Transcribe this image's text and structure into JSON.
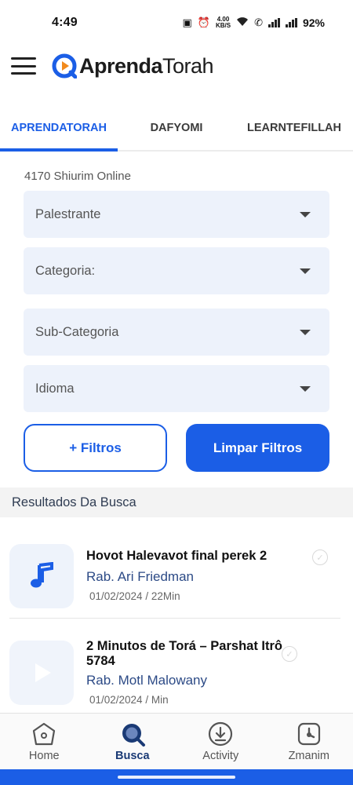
{
  "status_bar": {
    "time": "4:49",
    "speed_top": "4.00",
    "speed_bottom": "KB/S",
    "battery": "92%"
  },
  "header": {
    "brand_bold": "Aprenda",
    "brand_light": "Torah",
    "accent_color": "#1b5ee6"
  },
  "tabs": [
    {
      "label": "APRENDATORAH",
      "active": true
    },
    {
      "label": "DAFYOMI",
      "active": false
    },
    {
      "label": "LEARNTEFILLAH",
      "active": false
    }
  ],
  "filters": {
    "count_label": "4170 Shiurim Online",
    "selects": [
      {
        "placeholder": "Palestrante"
      },
      {
        "placeholder": "Categoria:"
      },
      {
        "placeholder": "Sub-Categoria"
      },
      {
        "placeholder": "Idioma"
      }
    ],
    "more_filters_label": "+ Filtros",
    "clear_filters_label": "Limpar Filtros"
  },
  "results": {
    "heading": "Resultados Da Busca",
    "items": [
      {
        "title": "Hovot Halevavot final perek 2",
        "author": "Rab. Ari Friedman",
        "meta": "01/02/2024 / 22Min",
        "media_icon": "music-note-icon"
      },
      {
        "title": "2 Minutos de Torá – Parshat Itrô 5784",
        "author": "Rab. Motl Malowany",
        "meta": "01/02/2024 / Min",
        "media_icon": "play-icon"
      }
    ]
  },
  "bottom_nav": [
    {
      "label": "Home",
      "icon": "home-icon",
      "active": false
    },
    {
      "label": "Busca",
      "icon": "search-icon",
      "active": true
    },
    {
      "label": "Activity",
      "icon": "download-icon",
      "active": false
    },
    {
      "label": "Zmanim",
      "icon": "clock-icon",
      "active": false
    }
  ]
}
